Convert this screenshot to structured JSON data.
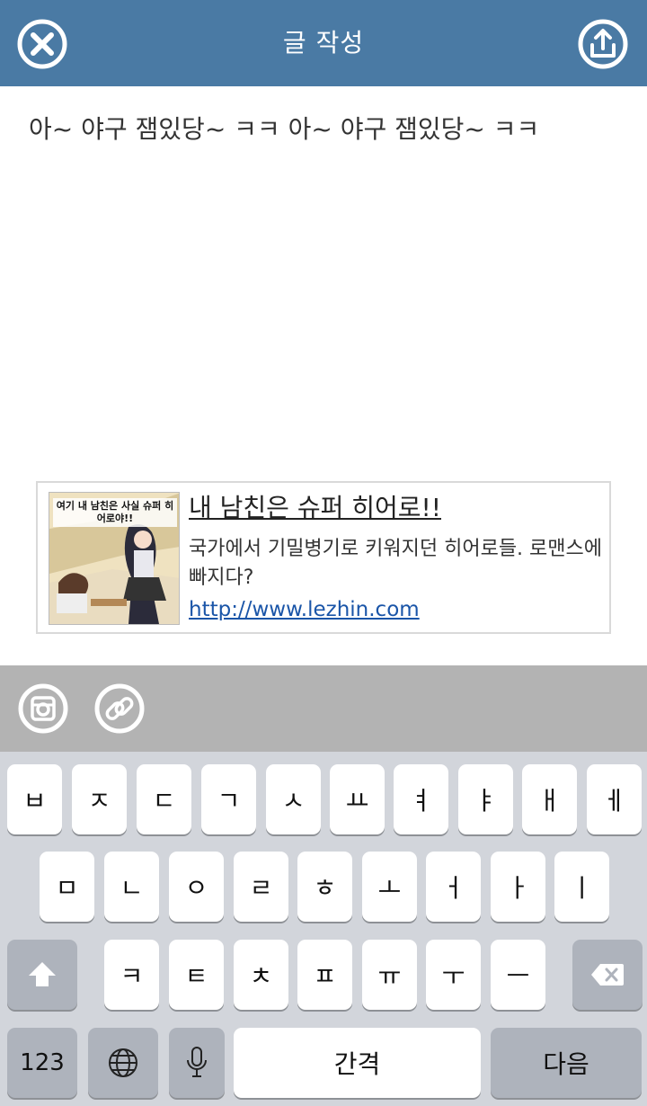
{
  "header": {
    "title": "글 작성",
    "close_icon": "close-icon",
    "share_icon": "share-upload-icon",
    "bg_color": "#4a7aa4"
  },
  "editor": {
    "text": "아~ 야구 잼있당~ ㅋㅋ 아~ 야구 잼있당~ ㅋㅋ"
  },
  "link_card": {
    "thumb_caption": "여기 내 남친은 사실 슈퍼 히어로야!!",
    "title": "내 남친은 슈퍼 히어로!!",
    "description": "국가에서 기밀병기로 키워지던 히어로들. 로맨스에 빠지다?",
    "url": "http://www.lezhin.com"
  },
  "attach_bar": {
    "instagram_icon": "instagram-icon",
    "link_icon": "link-icon"
  },
  "keyboard": {
    "row1": [
      "ㅂ",
      "ㅈ",
      "ㄷ",
      "ㄱ",
      "ㅅ",
      "ㅛ",
      "ㅕ",
      "ㅑ",
      "ㅐ",
      "ㅔ"
    ],
    "row2": [
      "ㅁ",
      "ㄴ",
      "ㅇ",
      "ㄹ",
      "ㅎ",
      "ㅗ",
      "ㅓ",
      "ㅏ",
      "ㅣ"
    ],
    "row3": [
      "ㅋ",
      "ㅌ",
      "ㅊ",
      "ㅍ",
      "ㅠ",
      "ㅜ",
      "ㅡ"
    ],
    "numbers_label": "123",
    "space_label": "간격",
    "return_label": "다음",
    "shift_icon": "shift-arrow-icon",
    "delete_icon": "backspace-icon",
    "globe_icon": "globe-icon",
    "mic_icon": "microphone-icon"
  }
}
